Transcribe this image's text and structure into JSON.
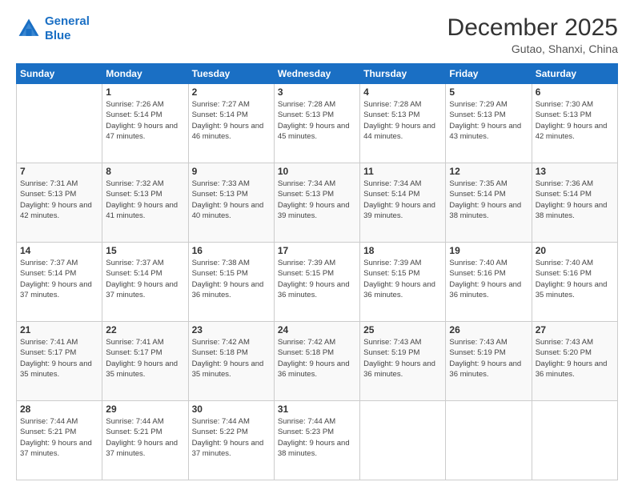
{
  "logo": {
    "line1": "General",
    "line2": "Blue"
  },
  "header": {
    "month_year": "December 2025",
    "location": "Gutao, Shanxi, China"
  },
  "weekdays": [
    "Sunday",
    "Monday",
    "Tuesday",
    "Wednesday",
    "Thursday",
    "Friday",
    "Saturday"
  ],
  "weeks": [
    [
      {
        "day": "",
        "sunrise": "",
        "sunset": "",
        "daylight": ""
      },
      {
        "day": "1",
        "sunrise": "Sunrise: 7:26 AM",
        "sunset": "Sunset: 5:14 PM",
        "daylight": "Daylight: 9 hours and 47 minutes."
      },
      {
        "day": "2",
        "sunrise": "Sunrise: 7:27 AM",
        "sunset": "Sunset: 5:14 PM",
        "daylight": "Daylight: 9 hours and 46 minutes."
      },
      {
        "day": "3",
        "sunrise": "Sunrise: 7:28 AM",
        "sunset": "Sunset: 5:13 PM",
        "daylight": "Daylight: 9 hours and 45 minutes."
      },
      {
        "day": "4",
        "sunrise": "Sunrise: 7:28 AM",
        "sunset": "Sunset: 5:13 PM",
        "daylight": "Daylight: 9 hours and 44 minutes."
      },
      {
        "day": "5",
        "sunrise": "Sunrise: 7:29 AM",
        "sunset": "Sunset: 5:13 PM",
        "daylight": "Daylight: 9 hours and 43 minutes."
      },
      {
        "day": "6",
        "sunrise": "Sunrise: 7:30 AM",
        "sunset": "Sunset: 5:13 PM",
        "daylight": "Daylight: 9 hours and 42 minutes."
      }
    ],
    [
      {
        "day": "7",
        "sunrise": "Sunrise: 7:31 AM",
        "sunset": "Sunset: 5:13 PM",
        "daylight": "Daylight: 9 hours and 42 minutes."
      },
      {
        "day": "8",
        "sunrise": "Sunrise: 7:32 AM",
        "sunset": "Sunset: 5:13 PM",
        "daylight": "Daylight: 9 hours and 41 minutes."
      },
      {
        "day": "9",
        "sunrise": "Sunrise: 7:33 AM",
        "sunset": "Sunset: 5:13 PM",
        "daylight": "Daylight: 9 hours and 40 minutes."
      },
      {
        "day": "10",
        "sunrise": "Sunrise: 7:34 AM",
        "sunset": "Sunset: 5:13 PM",
        "daylight": "Daylight: 9 hours and 39 minutes."
      },
      {
        "day": "11",
        "sunrise": "Sunrise: 7:34 AM",
        "sunset": "Sunset: 5:14 PM",
        "daylight": "Daylight: 9 hours and 39 minutes."
      },
      {
        "day": "12",
        "sunrise": "Sunrise: 7:35 AM",
        "sunset": "Sunset: 5:14 PM",
        "daylight": "Daylight: 9 hours and 38 minutes."
      },
      {
        "day": "13",
        "sunrise": "Sunrise: 7:36 AM",
        "sunset": "Sunset: 5:14 PM",
        "daylight": "Daylight: 9 hours and 38 minutes."
      }
    ],
    [
      {
        "day": "14",
        "sunrise": "Sunrise: 7:37 AM",
        "sunset": "Sunset: 5:14 PM",
        "daylight": "Daylight: 9 hours and 37 minutes."
      },
      {
        "day": "15",
        "sunrise": "Sunrise: 7:37 AM",
        "sunset": "Sunset: 5:14 PM",
        "daylight": "Daylight: 9 hours and 37 minutes."
      },
      {
        "day": "16",
        "sunrise": "Sunrise: 7:38 AM",
        "sunset": "Sunset: 5:15 PM",
        "daylight": "Daylight: 9 hours and 36 minutes."
      },
      {
        "day": "17",
        "sunrise": "Sunrise: 7:39 AM",
        "sunset": "Sunset: 5:15 PM",
        "daylight": "Daylight: 9 hours and 36 minutes."
      },
      {
        "day": "18",
        "sunrise": "Sunrise: 7:39 AM",
        "sunset": "Sunset: 5:15 PM",
        "daylight": "Daylight: 9 hours and 36 minutes."
      },
      {
        "day": "19",
        "sunrise": "Sunrise: 7:40 AM",
        "sunset": "Sunset: 5:16 PM",
        "daylight": "Daylight: 9 hours and 36 minutes."
      },
      {
        "day": "20",
        "sunrise": "Sunrise: 7:40 AM",
        "sunset": "Sunset: 5:16 PM",
        "daylight": "Daylight: 9 hours and 35 minutes."
      }
    ],
    [
      {
        "day": "21",
        "sunrise": "Sunrise: 7:41 AM",
        "sunset": "Sunset: 5:17 PM",
        "daylight": "Daylight: 9 hours and 35 minutes."
      },
      {
        "day": "22",
        "sunrise": "Sunrise: 7:41 AM",
        "sunset": "Sunset: 5:17 PM",
        "daylight": "Daylight: 9 hours and 35 minutes."
      },
      {
        "day": "23",
        "sunrise": "Sunrise: 7:42 AM",
        "sunset": "Sunset: 5:18 PM",
        "daylight": "Daylight: 9 hours and 35 minutes."
      },
      {
        "day": "24",
        "sunrise": "Sunrise: 7:42 AM",
        "sunset": "Sunset: 5:18 PM",
        "daylight": "Daylight: 9 hours and 36 minutes."
      },
      {
        "day": "25",
        "sunrise": "Sunrise: 7:43 AM",
        "sunset": "Sunset: 5:19 PM",
        "daylight": "Daylight: 9 hours and 36 minutes."
      },
      {
        "day": "26",
        "sunrise": "Sunrise: 7:43 AM",
        "sunset": "Sunset: 5:19 PM",
        "daylight": "Daylight: 9 hours and 36 minutes."
      },
      {
        "day": "27",
        "sunrise": "Sunrise: 7:43 AM",
        "sunset": "Sunset: 5:20 PM",
        "daylight": "Daylight: 9 hours and 36 minutes."
      }
    ],
    [
      {
        "day": "28",
        "sunrise": "Sunrise: 7:44 AM",
        "sunset": "Sunset: 5:21 PM",
        "daylight": "Daylight: 9 hours and 37 minutes."
      },
      {
        "day": "29",
        "sunrise": "Sunrise: 7:44 AM",
        "sunset": "Sunset: 5:21 PM",
        "daylight": "Daylight: 9 hours and 37 minutes."
      },
      {
        "day": "30",
        "sunrise": "Sunrise: 7:44 AM",
        "sunset": "Sunset: 5:22 PM",
        "daylight": "Daylight: 9 hours and 37 minutes."
      },
      {
        "day": "31",
        "sunrise": "Sunrise: 7:44 AM",
        "sunset": "Sunset: 5:23 PM",
        "daylight": "Daylight: 9 hours and 38 minutes."
      },
      {
        "day": "",
        "sunrise": "",
        "sunset": "",
        "daylight": ""
      },
      {
        "day": "",
        "sunrise": "",
        "sunset": "",
        "daylight": ""
      },
      {
        "day": "",
        "sunrise": "",
        "sunset": "",
        "daylight": ""
      }
    ]
  ]
}
